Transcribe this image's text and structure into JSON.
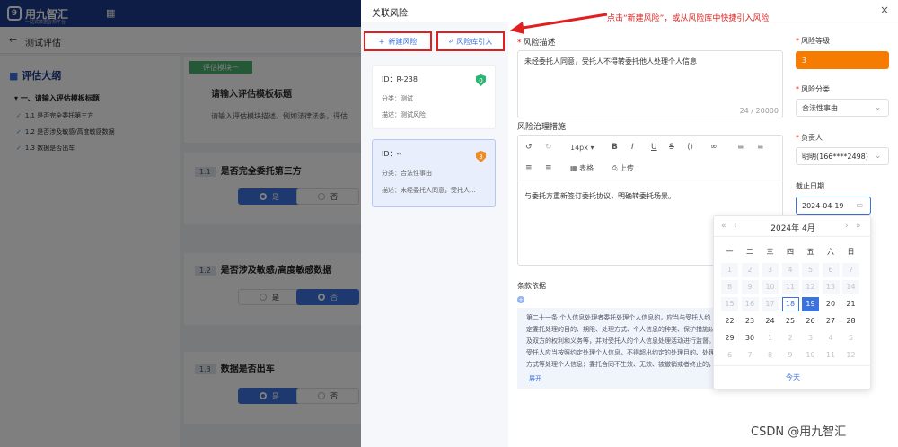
{
  "app": {
    "logo_text": "用九智汇",
    "logo_sub": "一站式数据合规平台"
  },
  "breadcrumb": {
    "back_icon": "arrow-left-icon",
    "title": "测试评估"
  },
  "sidebar": {
    "title": "评估大纲",
    "section": "一、请输入评估模板标题",
    "items": [
      "1.1 是否完全委托第三方",
      "1.2 是否涉及敏感/高度敏感数据",
      "1.3 数据是否出车"
    ]
  },
  "main": {
    "module_tag": "评估模块一",
    "template_title": "请输入评估模板标题",
    "template_desc": "请输入评估模块描述，例如法律法条，评估",
    "questions": [
      {
        "num": "1.1",
        "text": "是否完全委托第三方",
        "yes": "是",
        "no": "否",
        "selected": "是"
      },
      {
        "num": "1.2",
        "text": "是否涉及敏感/高度敏感数据",
        "yes": "是",
        "no": "否",
        "selected": "否"
      },
      {
        "num": "1.3",
        "text": "数据是否出车",
        "yes": "是",
        "no": "否",
        "selected": "是"
      }
    ]
  },
  "drawer": {
    "title": "关联风险",
    "close": "×",
    "new_risk": "新建风险",
    "import_risk": "风险库引入",
    "annotation": "点击“新建风险”，或从风险库中快捷引入风险",
    "risks": [
      {
        "id": "ID：R-238",
        "category": "分类：测试",
        "desc": "描述：测试风险",
        "level": "0",
        "level_color": "#2bb673"
      },
      {
        "id": "ID：--",
        "category": "分类：合法性事由",
        "desc": "描述：未经委托人同意，受托人...",
        "level": "3",
        "level_color": "#f08a24"
      }
    ],
    "form": {
      "desc_label": "风险描述",
      "desc_value": "未经委托人同意，受托人不得转委托他人处理个人信息",
      "desc_counter": "24 / 20000",
      "measure_label": "风险治理措施",
      "toolbar": {
        "font_size": "14px",
        "table": "表格",
        "upload": "上传"
      },
      "measure_value": "与委托方重新签订委托协议，明确转委托场景。",
      "basis_label": "条款依据",
      "basis_text": "第二十一条 个人信息处理者委托处理个人信息的，应当与受托人约定委托处理的目的、期限、处理方式、个人信息的种类、保护措施以及双方的权利和义务等，并对受托人的个人信息处理活动进行监督。受托人应当按照约定处理个人信息，不得超出约定的处理目的、处理方式等处理个人信息；委托合同不生效、无效、被撤销或者终止的，受托人应当将个人信息返还个人信息处理者或者予以删除，不得保留。",
      "expand": "展开",
      "level_label": "风险等级",
      "level_value": "3",
      "category_label": "风险分类",
      "category_value": "合法性事由",
      "owner_label": "负责人",
      "owner_value": "明明(166****2498)",
      "deadline_label": "截止日期",
      "deadline_value": "2024-04-19"
    },
    "calendar": {
      "header": "2024年  4月",
      "weekdays": [
        "一",
        "二",
        "三",
        "四",
        "五",
        "六",
        "日"
      ],
      "today_label": "今天",
      "selected_day": 19,
      "today_day": 18
    }
  },
  "watermark": "CSDN @用九智汇"
}
